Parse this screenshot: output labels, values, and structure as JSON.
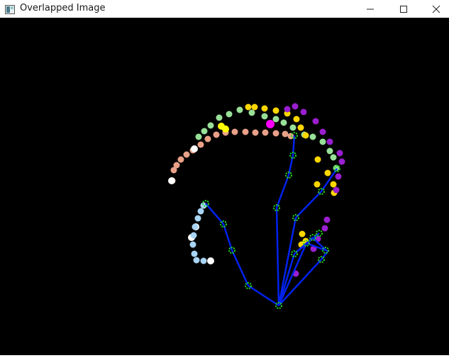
{
  "window": {
    "title": "Overlapped Image",
    "app_icon": "image-window-icon",
    "controls": [
      "minimize-icon",
      "maximize-icon",
      "close-icon"
    ]
  },
  "colors": {
    "background": "#000000",
    "skeleton_line": "#0022ee",
    "joint_ring": "#22dd22",
    "salmon": "#e8a088",
    "light_green": "#98e098",
    "gold": "#ffd700",
    "violet": "#9a1fd0",
    "white": "#ffffff",
    "light_blue": "#a8d4f4",
    "magenta": "#ff00ff",
    "yellow": "#ffff00"
  }
}
